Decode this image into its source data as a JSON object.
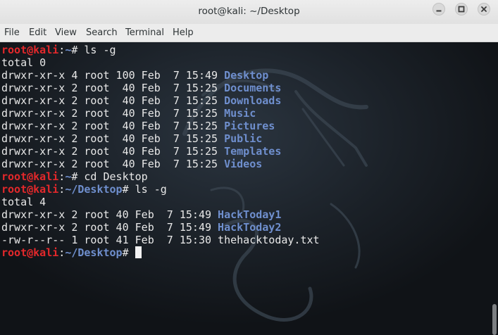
{
  "window": {
    "title": "root@kali: ~/Desktop",
    "controls": [
      "minimize-icon",
      "maximize-icon",
      "close-icon"
    ]
  },
  "menubar": {
    "items": [
      "File",
      "Edit",
      "View",
      "Search",
      "Terminal",
      "Help"
    ]
  },
  "terminal": {
    "prompts": [
      {
        "user": "root@kali",
        "sep": ":",
        "path": "~",
        "symbol": "# ",
        "command": "ls -g"
      },
      {
        "user": "root@kali",
        "sep": ":",
        "path": "~",
        "symbol": "# ",
        "command": "cd Desktop"
      },
      {
        "user": "root@kali",
        "sep": ":",
        "path": "~/Desktop",
        "symbol": "# ",
        "command": "ls -g"
      },
      {
        "user": "root@kali",
        "sep": ":",
        "path": "~/Desktop",
        "symbol": "# ",
        "command": ""
      }
    ],
    "total_home": "total 0",
    "home_entries": [
      {
        "meta": "drwxr-xr-x 4 root 100 Feb  7 15:49 ",
        "name": "Desktop"
      },
      {
        "meta": "drwxr-xr-x 2 root  40 Feb  7 15:25 ",
        "name": "Documents"
      },
      {
        "meta": "drwxr-xr-x 2 root  40 Feb  7 15:25 ",
        "name": "Downloads"
      },
      {
        "meta": "drwxr-xr-x 2 root  40 Feb  7 15:25 ",
        "name": "Music"
      },
      {
        "meta": "drwxr-xr-x 2 root  40 Feb  7 15:25 ",
        "name": "Pictures"
      },
      {
        "meta": "drwxr-xr-x 2 root  40 Feb  7 15:25 ",
        "name": "Public"
      },
      {
        "meta": "drwxr-xr-x 2 root  40 Feb  7 15:25 ",
        "name": "Templates"
      },
      {
        "meta": "drwxr-xr-x 2 root  40 Feb  7 15:25 ",
        "name": "Videos"
      }
    ],
    "total_desktop": "total 4",
    "desktop_entries": [
      {
        "meta": "drwxr-xr-x 2 root 40 Feb  7 15:49 ",
        "name": "HackToday1"
      },
      {
        "meta": "drwxr-xr-x 2 root 40 Feb  7 15:49 ",
        "name": "HackToday2"
      },
      {
        "meta": "-rw-r--r-- 1 root 41 Feb  7 15:30 ",
        "name": "thehacktoday.txt"
      }
    ]
  },
  "colors": {
    "prompt_user": "#e3282b",
    "prompt_path": "#6f8fce",
    "directory": "#6f8fce",
    "text": "#e8e8e8",
    "background": "#101317"
  }
}
